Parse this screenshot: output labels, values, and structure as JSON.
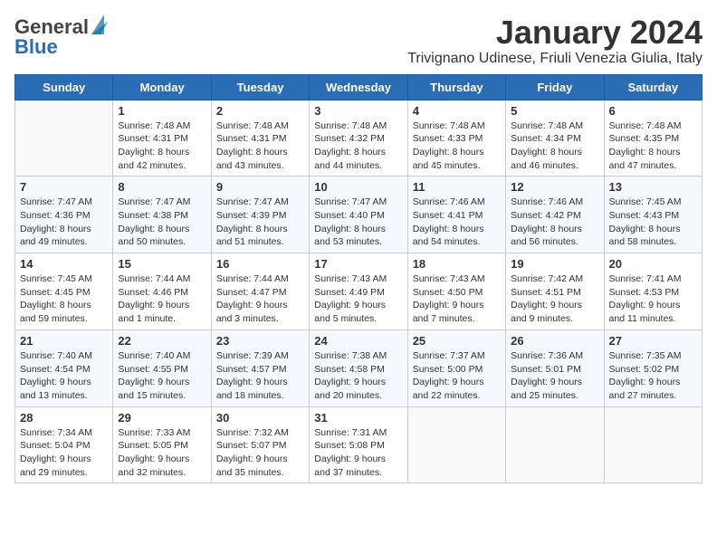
{
  "logo": {
    "general": "General",
    "blue": "Blue",
    "tagline": ""
  },
  "header": {
    "month_title": "January 2024",
    "location": "Trivignano Udinese, Friuli Venezia Giulia, Italy"
  },
  "days_of_week": [
    "Sunday",
    "Monday",
    "Tuesday",
    "Wednesday",
    "Thursday",
    "Friday",
    "Saturday"
  ],
  "weeks": [
    [
      {
        "day": "",
        "info": ""
      },
      {
        "day": "1",
        "info": "Sunrise: 7:48 AM\nSunset: 4:31 PM\nDaylight: 8 hours\nand 42 minutes."
      },
      {
        "day": "2",
        "info": "Sunrise: 7:48 AM\nSunset: 4:31 PM\nDaylight: 8 hours\nand 43 minutes."
      },
      {
        "day": "3",
        "info": "Sunrise: 7:48 AM\nSunset: 4:32 PM\nDaylight: 8 hours\nand 44 minutes."
      },
      {
        "day": "4",
        "info": "Sunrise: 7:48 AM\nSunset: 4:33 PM\nDaylight: 8 hours\nand 45 minutes."
      },
      {
        "day": "5",
        "info": "Sunrise: 7:48 AM\nSunset: 4:34 PM\nDaylight: 8 hours\nand 46 minutes."
      },
      {
        "day": "6",
        "info": "Sunrise: 7:48 AM\nSunset: 4:35 PM\nDaylight: 8 hours\nand 47 minutes."
      }
    ],
    [
      {
        "day": "7",
        "info": "Sunrise: 7:47 AM\nSunset: 4:36 PM\nDaylight: 8 hours\nand 49 minutes."
      },
      {
        "day": "8",
        "info": "Sunrise: 7:47 AM\nSunset: 4:38 PM\nDaylight: 8 hours\nand 50 minutes."
      },
      {
        "day": "9",
        "info": "Sunrise: 7:47 AM\nSunset: 4:39 PM\nDaylight: 8 hours\nand 51 minutes."
      },
      {
        "day": "10",
        "info": "Sunrise: 7:47 AM\nSunset: 4:40 PM\nDaylight: 8 hours\nand 53 minutes."
      },
      {
        "day": "11",
        "info": "Sunrise: 7:46 AM\nSunset: 4:41 PM\nDaylight: 8 hours\nand 54 minutes."
      },
      {
        "day": "12",
        "info": "Sunrise: 7:46 AM\nSunset: 4:42 PM\nDaylight: 8 hours\nand 56 minutes."
      },
      {
        "day": "13",
        "info": "Sunrise: 7:45 AM\nSunset: 4:43 PM\nDaylight: 8 hours\nand 58 minutes."
      }
    ],
    [
      {
        "day": "14",
        "info": "Sunrise: 7:45 AM\nSunset: 4:45 PM\nDaylight: 8 hours\nand 59 minutes."
      },
      {
        "day": "15",
        "info": "Sunrise: 7:44 AM\nSunset: 4:46 PM\nDaylight: 9 hours\nand 1 minute."
      },
      {
        "day": "16",
        "info": "Sunrise: 7:44 AM\nSunset: 4:47 PM\nDaylight: 9 hours\nand 3 minutes."
      },
      {
        "day": "17",
        "info": "Sunrise: 7:43 AM\nSunset: 4:49 PM\nDaylight: 9 hours\nand 5 minutes."
      },
      {
        "day": "18",
        "info": "Sunrise: 7:43 AM\nSunset: 4:50 PM\nDaylight: 9 hours\nand 7 minutes."
      },
      {
        "day": "19",
        "info": "Sunrise: 7:42 AM\nSunset: 4:51 PM\nDaylight: 9 hours\nand 9 minutes."
      },
      {
        "day": "20",
        "info": "Sunrise: 7:41 AM\nSunset: 4:53 PM\nDaylight: 9 hours\nand 11 minutes."
      }
    ],
    [
      {
        "day": "21",
        "info": "Sunrise: 7:40 AM\nSunset: 4:54 PM\nDaylight: 9 hours\nand 13 minutes."
      },
      {
        "day": "22",
        "info": "Sunrise: 7:40 AM\nSunset: 4:55 PM\nDaylight: 9 hours\nand 15 minutes."
      },
      {
        "day": "23",
        "info": "Sunrise: 7:39 AM\nSunset: 4:57 PM\nDaylight: 9 hours\nand 18 minutes."
      },
      {
        "day": "24",
        "info": "Sunrise: 7:38 AM\nSunset: 4:58 PM\nDaylight: 9 hours\nand 20 minutes."
      },
      {
        "day": "25",
        "info": "Sunrise: 7:37 AM\nSunset: 5:00 PM\nDaylight: 9 hours\nand 22 minutes."
      },
      {
        "day": "26",
        "info": "Sunrise: 7:36 AM\nSunset: 5:01 PM\nDaylight: 9 hours\nand 25 minutes."
      },
      {
        "day": "27",
        "info": "Sunrise: 7:35 AM\nSunset: 5:02 PM\nDaylight: 9 hours\nand 27 minutes."
      }
    ],
    [
      {
        "day": "28",
        "info": "Sunrise: 7:34 AM\nSunset: 5:04 PM\nDaylight: 9 hours\nand 29 minutes."
      },
      {
        "day": "29",
        "info": "Sunrise: 7:33 AM\nSunset: 5:05 PM\nDaylight: 9 hours\nand 32 minutes."
      },
      {
        "day": "30",
        "info": "Sunrise: 7:32 AM\nSunset: 5:07 PM\nDaylight: 9 hours\nand 35 minutes."
      },
      {
        "day": "31",
        "info": "Sunrise: 7:31 AM\nSunset: 5:08 PM\nDaylight: 9 hours\nand 37 minutes."
      },
      {
        "day": "",
        "info": ""
      },
      {
        "day": "",
        "info": ""
      },
      {
        "day": "",
        "info": ""
      }
    ]
  ]
}
